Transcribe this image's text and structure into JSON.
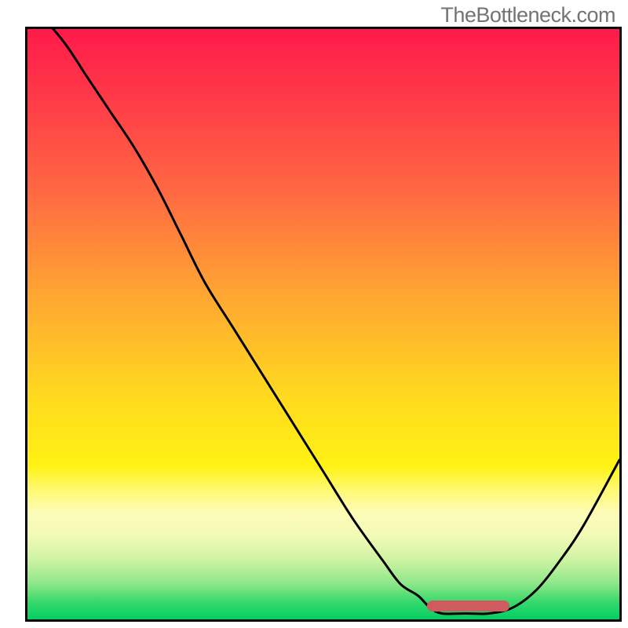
{
  "watermark": "TheBottleneck.com",
  "layout": {
    "stage_w": 800,
    "stage_h": 800,
    "plot_left": 32,
    "plot_top": 34,
    "plot_right": 792,
    "plot_bottom": 792
  },
  "gradient_stops": [
    {
      "pct": 0,
      "color": "#ff1a4a"
    },
    {
      "pct": 12,
      "color": "#ff3b48"
    },
    {
      "pct": 28,
      "color": "#ff6a42"
    },
    {
      "pct": 45,
      "color": "#ffa632"
    },
    {
      "pct": 62,
      "color": "#ffd91f"
    },
    {
      "pct": 74,
      "color": "#fff214"
    },
    {
      "pct": 78,
      "color": "#fff971"
    },
    {
      "pct": 82,
      "color": "#fdfcb8"
    },
    {
      "pct": 86,
      "color": "#f1fab5"
    },
    {
      "pct": 90,
      "color": "#ccf3a2"
    },
    {
      "pct": 94,
      "color": "#8ce788"
    },
    {
      "pct": 97,
      "color": "#38d96c"
    },
    {
      "pct": 100,
      "color": "#00cf63"
    }
  ],
  "marker": {
    "x_frac_left": 0.675,
    "x_frac_right": 0.815,
    "y_frac": 0.978
  },
  "chart_data": {
    "type": "line",
    "title": "",
    "xlabel": "",
    "ylabel": "",
    "xlim": [
      0,
      100
    ],
    "ylim": [
      0,
      100
    ],
    "series": [
      {
        "name": "bottleneck-curve",
        "x": [
          0,
          6,
          10,
          14,
          18,
          22,
          26,
          30,
          35,
          40,
          45,
          50,
          55,
          60,
          63,
          66,
          68,
          70,
          74,
          78,
          82,
          86,
          90,
          94,
          100
        ],
        "y": [
          105,
          98,
          92,
          86,
          80,
          73,
          65,
          57,
          49,
          41,
          33,
          25,
          17,
          10,
          6,
          4,
          2,
          1,
          1,
          1,
          2,
          5,
          10,
          16,
          27
        ]
      }
    ],
    "annotations": [
      {
        "type": "marker-bar",
        "x_start": 67.5,
        "x_end": 81.5,
        "y": 2.2,
        "color": "#cf5b5e"
      }
    ]
  }
}
